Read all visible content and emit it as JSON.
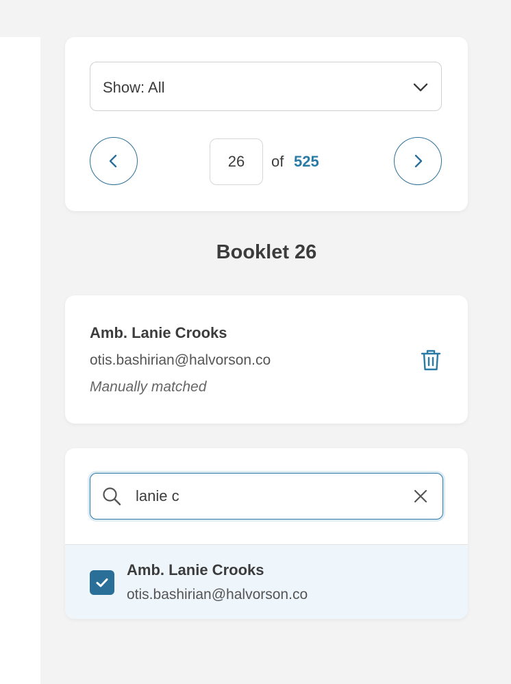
{
  "filter": {
    "label": "Show: All"
  },
  "pagination": {
    "current_page": "26",
    "of_label": "of",
    "total_pages": "525"
  },
  "booklet": {
    "title": "Booklet 26"
  },
  "matched": {
    "name": "Amb. Lanie Crooks",
    "email": "otis.bashirian@halvorson.co",
    "status": "Manually matched"
  },
  "search": {
    "value": "lanie c"
  },
  "results": [
    {
      "name": "Amb. Lanie Crooks",
      "email": "otis.bashirian@halvorson.co",
      "checked": true
    }
  ],
  "colors": {
    "accent": "#2a6f98",
    "link": "#2a7aa6",
    "selected_row_bg": "#eef5fb",
    "page_bg": "#f3f3f3"
  },
  "icons": {
    "filter_dropdown": "chevron-down-icon",
    "prev": "chevron-left-icon",
    "next": "chevron-right-icon",
    "delete": "trash-icon",
    "search": "search-icon",
    "clear": "close-icon",
    "checkbox": "check-icon"
  }
}
